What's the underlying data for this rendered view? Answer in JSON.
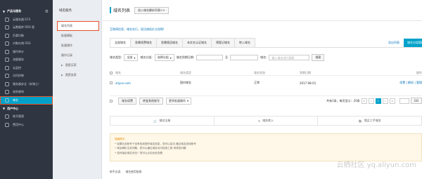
{
  "sidebar": {
    "group1": "产品与服务",
    "items": [
      {
        "label": "云服务器 ECS",
        "icon": "server-icon"
      },
      {
        "label": "云数据库 RDS 版",
        "icon": "database-icon"
      },
      {
        "label": "负载均衡",
        "icon": "balance-icon"
      },
      {
        "label": "对象存储 OSS",
        "icon": "storage-icon"
      },
      {
        "label": "操作审计",
        "icon": "audit-icon"
      },
      {
        "label": "流量服务",
        "icon": "traffic-icon"
      },
      {
        "label": "云监控",
        "icon": "monitor-icon"
      },
      {
        "label": "访问控制",
        "icon": "access-icon"
      },
      {
        "label": "服务器安全（安骑士）",
        "icon": "shield-icon"
      },
      {
        "label": "态势感知",
        "icon": "radar-icon"
      },
      {
        "label": "域名",
        "icon": "globe-icon"
      }
    ],
    "group2": "用户中心",
    "items2": [
      {
        "label": "账号管理",
        "icon": "user-icon"
      },
      {
        "label": "费用中心",
        "icon": "money-icon"
      }
    ]
  },
  "subnav": {
    "title": "域名服务",
    "items": [
      {
        "label": "域名列表"
      },
      {
        "label": "批量模板"
      },
      {
        "label": "批量操作"
      },
      {
        "label": "操作记录"
      },
      {
        "label": "我是买家"
      },
      {
        "label": "我是卖家"
      }
    ]
  },
  "header": {
    "title": "域名列表",
    "dns_button": "进入域名解析列表>>"
  },
  "notice": "互联网信息，域名先行，现注册低价立抢购!",
  "tabs": [
    "全部域名",
    "急需续费域名",
    "急需赎回域名",
    "未实名认证域名",
    "预登记域名",
    "转入域名"
  ],
  "tab_actions": {
    "export": "导出列表",
    "manage": "域名分组管理"
  },
  "filters": {
    "type_label": "域名类型:",
    "type_value": "全部",
    "group_label": "域名分组:",
    "group_value": "选择分组",
    "expiry_label": "域名到期日期:",
    "to_label": "至",
    "domain_label": "域名:",
    "domain_placeholder": "输入域名进行搜索",
    "search_button": "搜索"
  },
  "table": {
    "headers": [
      "域名",
      "域名类型",
      "域名状态",
      "到期日期",
      "操作"
    ],
    "rows": [
      {
        "domain": "aliyun.com",
        "type": "国内域名",
        "status": "正常",
        "expiry": "2017-08-01",
        "actions": "续费 | 解析 | 管理"
      }
    ]
  },
  "footer": {
    "renew": "域名续费",
    "transfer": "转变其他账号",
    "more": "更多批量操作",
    "summary": "共有1条，每页显示：20条",
    "page": "1",
    "go": "GO"
  },
  "actions": [
    {
      "label": "域名注册",
      "icon": "cart-icon"
    },
    {
      "label": "域名转入",
      "icon": "pencil-icon"
    },
    {
      "label": "我买二手域名",
      "icon": "bag-icon"
    }
  ],
  "tips": {
    "title": "温馨提示:",
    "lines": [
      "• 如果在此账号下没有找到您的域名信息，您可以尝试 通过域名查找账号",
      "• 域名解析生效问题，您可以通过域名访问检测工具 来排查问题",
      "• 如何保证域名安全？您可以点击此处查看"
    ]
  },
  "guide": {
    "label": "新手必读:",
    "link": "域名使用指南"
  },
  "watermark": "云栖社区 yq.aliyun.com"
}
